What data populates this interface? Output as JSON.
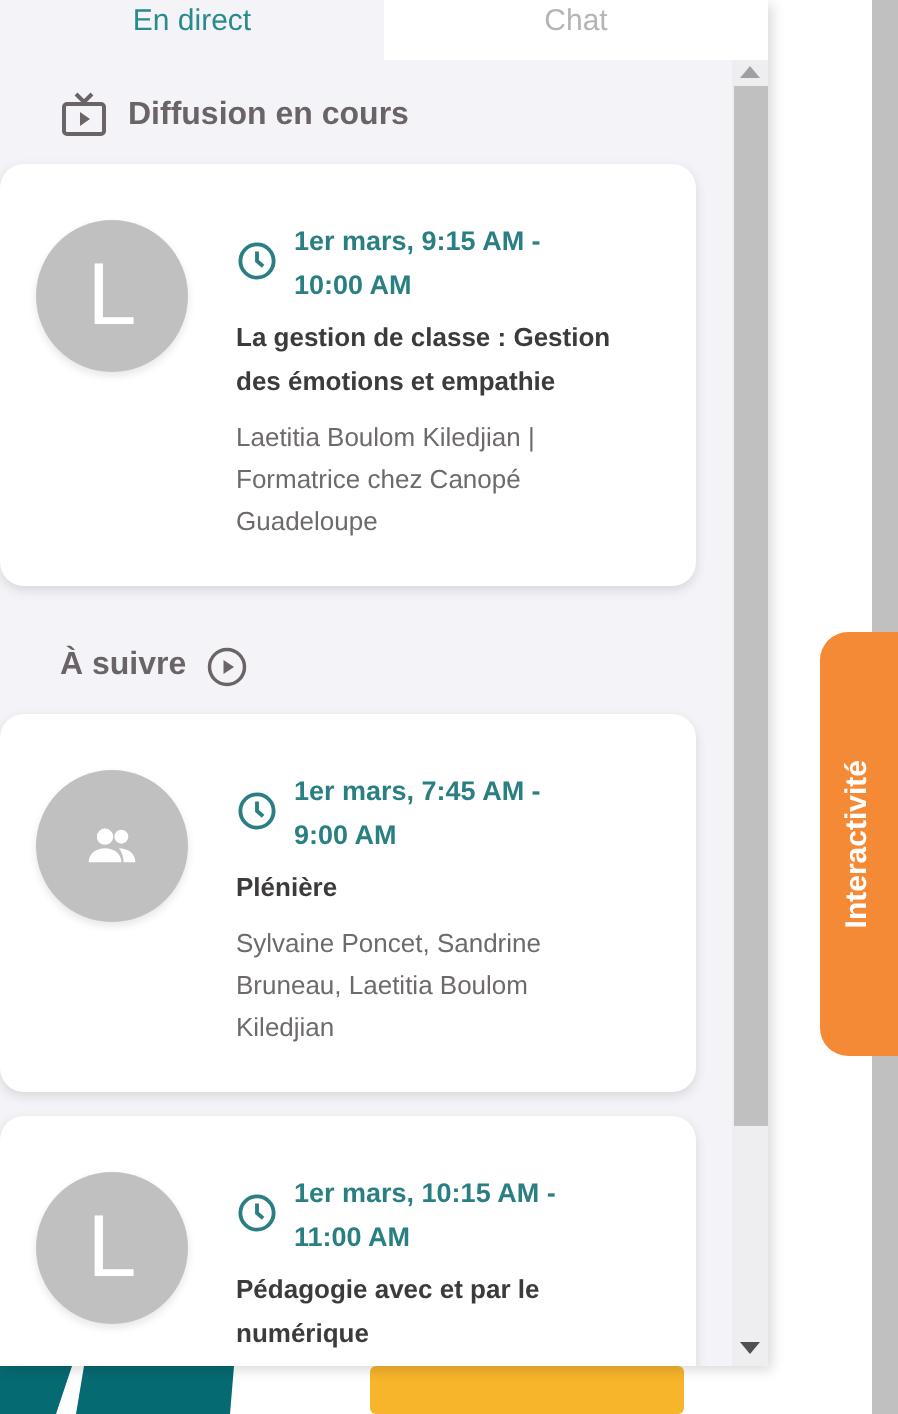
{
  "tabs": [
    {
      "label": "En direct",
      "selected": true
    },
    {
      "label": "Chat",
      "selected": false
    }
  ],
  "live_section": {
    "title": "Diffusion en cours"
  },
  "live_sessions": [
    {
      "avatar": {
        "kind": "letter",
        "text": "L"
      },
      "time": "1er mars, 9:15 AM - 10:00 AM",
      "title": "La gestion de classe : Gestion des émotions et empathie",
      "speakers": "Laetitia Boulom Kiledjian | Formatrice chez Canopé Guadeloupe"
    }
  ],
  "upcoming_section": {
    "title": "À suivre"
  },
  "upcoming_sessions": [
    {
      "avatar": {
        "kind": "group"
      },
      "time": "1er mars, 7:45 AM - 9:00 AM",
      "title": "Plénière",
      "speakers": "Sylvaine Poncet, Sandrine Bruneau, Laetitia Boulom Kiledjian"
    },
    {
      "avatar": {
        "kind": "letter",
        "text": "L"
      },
      "time": "1er mars, 10:15 AM - 11:00 AM",
      "title": "Pédagogie avec et par le numérique"
    }
  ],
  "side_tab": {
    "label": "Interactivité"
  }
}
